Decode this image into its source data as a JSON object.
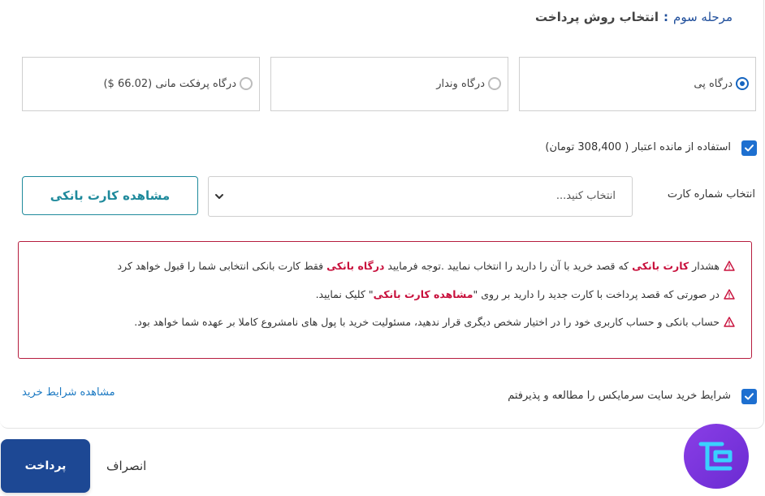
{
  "header": {
    "step": "مرحله سوم",
    "separator": ":",
    "title": "انتخاب روش پرداخت"
  },
  "gateways": [
    {
      "label": "درگاه پی",
      "selected": true
    },
    {
      "label": "درگاه وندار",
      "selected": false
    },
    {
      "label": "درگاه پرفکت مانی (66.02 $)",
      "selected": false
    }
  ],
  "credit": {
    "label": "استفاده از مانده اعتبار ( 308,400 تومان)",
    "checked": true
  },
  "card": {
    "label": "انتخاب شماره کارت",
    "placeholder": "انتخاب کنید...",
    "view_button": "مشاهده کارت بانکی"
  },
  "warnings": {
    "line1": {
      "prefix": "هشدار",
      "bold1": "کارت بانکی",
      "mid": "که قصد خرید با آن را دارید را انتخاب نمایید .توجه فرمایید",
      "bold2": "درگاه بانکی",
      "suffix": "فقط کارت بانکی انتخابی شما را قبول خواهد کرد"
    },
    "line2": {
      "prefix": "در صورتی که قصد پرداخت با کارت جدید را دارید بر روی \"",
      "bold": "مشاهده کارت بانکی",
      "suffix": "\" کلیک نمایید."
    },
    "line3": "حساب بانکی و حساب کاربری خود را در اختیار شخص دیگری قرار ندهید، مسئولیت خرید با پول های نامشروع کاملا بر عهده شما خواهد بود.",
    "accent_color": "#c8103c"
  },
  "terms": {
    "label": "شرایط خرید سایت سرمایکس را مطالعه و پذیرفتم",
    "checked": true,
    "link": "مشاهده شرایط خرید"
  },
  "actions": {
    "pay": "پرداخت",
    "cancel": "انصراف"
  },
  "icons": [
    "check-icon",
    "chevron-down-icon",
    "warning-icon",
    "logo-icon"
  ]
}
